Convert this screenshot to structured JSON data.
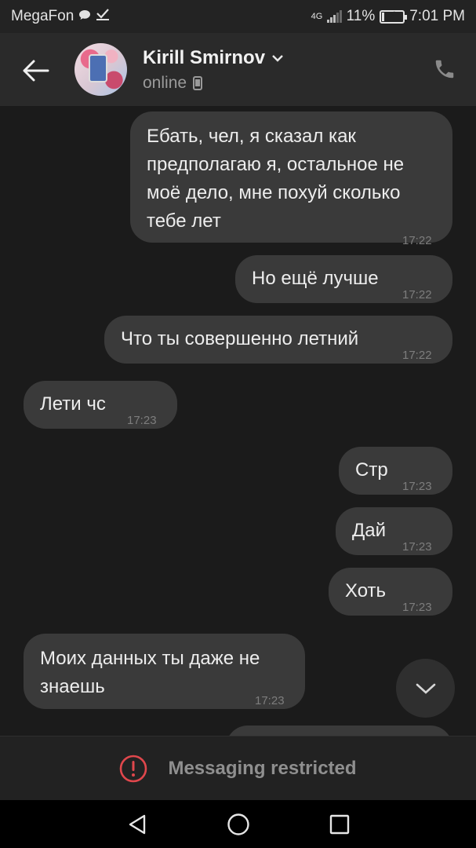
{
  "status_bar": {
    "carrier": "MegaFon",
    "network_type": "4G",
    "battery": "11%",
    "battery_level": 0.11,
    "time": "7:01 PM",
    "icons": [
      "chat-bubble-icon",
      "checkmark-icon",
      "signal-icon",
      "battery-charging-icon"
    ]
  },
  "header": {
    "contact_name": "Kirill Smirnov",
    "status": "online",
    "icons": [
      "back-arrow-icon",
      "chevron-down-icon",
      "mobile-device-icon",
      "phone-icon"
    ]
  },
  "messages": [
    {
      "direction": "out",
      "text": "Ебать, чел, я сказал как\nпредполагаю я, остальное не\nмоё дело, мне похуй сколько\nтебе лет",
      "time": "17:22"
    },
    {
      "direction": "out",
      "text": "Но ещё лучше",
      "time": "17:22"
    },
    {
      "direction": "out",
      "text": "Что ты совершенно летний",
      "time": "17:22"
    },
    {
      "direction": "in",
      "text": "Лети чс",
      "time": "17:23"
    },
    {
      "direction": "out",
      "text": "Стр",
      "time": "17:23"
    },
    {
      "direction": "out",
      "text": "Дай",
      "time": "17:23"
    },
    {
      "direction": "out",
      "text": "Хоть",
      "time": "17:23"
    },
    {
      "direction": "in",
      "text": "Моих данных ты даже не\nзнаешь",
      "time": "17:23"
    }
  ],
  "restricted": {
    "text": "Messaging restricted",
    "icon": "alert-circle-icon",
    "accent_color": "#e0474c"
  },
  "nav_bar": {
    "icons": [
      "back-triangle-icon",
      "home-circle-icon",
      "recents-square-icon"
    ]
  },
  "colors": {
    "background": "#1b1b1b",
    "header": "#2a2a2a",
    "bubble": "#3a3a3a"
  }
}
